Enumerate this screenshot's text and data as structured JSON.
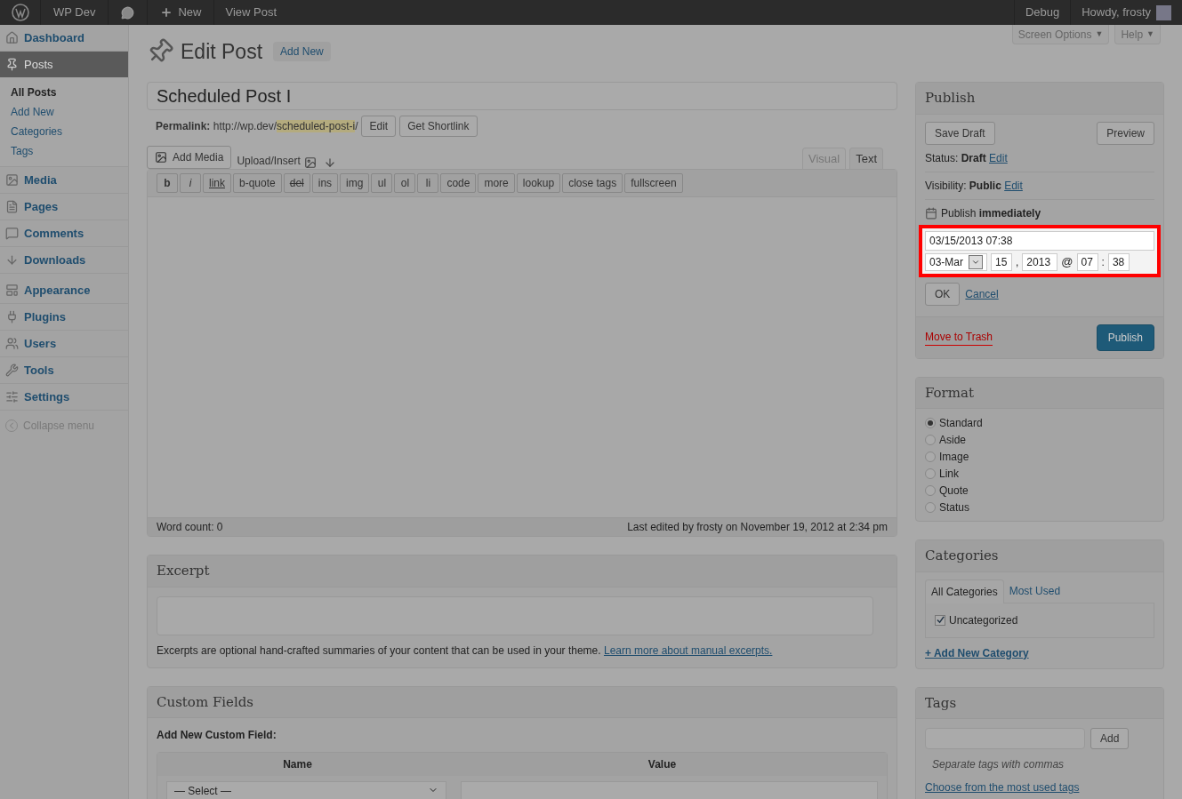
{
  "admin_bar": {
    "site": "WP Dev",
    "new": "New",
    "view": "View Post",
    "debug": "Debug",
    "howdy": "Howdy, frosty"
  },
  "screen_meta": [
    {
      "label": "Screen Options",
      "arrow": "▼"
    },
    {
      "label": "Help",
      "arrow": "▼"
    }
  ],
  "sidebar": {
    "items": [
      {
        "label": "Dashboard",
        "selected": false
      },
      {
        "label": "Posts",
        "selected": true,
        "children": [
          {
            "label": "All Posts",
            "selected": true
          },
          {
            "label": "Add New",
            "selected": false
          },
          {
            "label": "Categories",
            "selected": false
          },
          {
            "label": "Tags",
            "selected": false
          }
        ]
      },
      {
        "label": "Media",
        "selected": false
      },
      {
        "label": "Pages",
        "selected": false
      },
      {
        "label": "Comments",
        "selected": false
      },
      {
        "label": "Downloads",
        "selected": false
      },
      {
        "label": "Appearance",
        "selected": false
      },
      {
        "label": "Plugins",
        "selected": false
      },
      {
        "label": "Users",
        "selected": false
      },
      {
        "label": "Tools",
        "selected": false
      },
      {
        "label": "Settings",
        "selected": false
      }
    ],
    "collapse": "Collapse menu"
  },
  "heading": {
    "title": "Edit Post",
    "add_new": "Add New"
  },
  "post_title": "Scheduled Post I",
  "permalink": {
    "label": "Permalink:",
    "base": "http://wp.dev/",
    "slug": "scheduled-post-i",
    "trail": "/",
    "buttons": [
      "Edit",
      "Get Shortlink"
    ]
  },
  "media": {
    "add": "Add Media",
    "upload": "Upload/Insert"
  },
  "editor_tabs": [
    {
      "label": "Visual",
      "selected": false
    },
    {
      "label": "Text",
      "selected": true
    }
  ],
  "quicktags": [
    {
      "label": "b",
      "kind": "bold"
    },
    {
      "label": "i",
      "kind": "italic"
    },
    {
      "label": "link",
      "kind": "underline"
    },
    {
      "label": "b-quote",
      "kind": "plain"
    },
    {
      "label": "del",
      "kind": "strike"
    },
    {
      "label": "ins",
      "kind": "plain"
    },
    {
      "label": "img",
      "kind": "plain"
    },
    {
      "label": "ul",
      "kind": "plain"
    },
    {
      "label": "ol",
      "kind": "plain"
    },
    {
      "label": "li",
      "kind": "plain"
    },
    {
      "label": "code",
      "kind": "plain"
    },
    {
      "label": "more",
      "kind": "plain"
    },
    {
      "label": "lookup",
      "kind": "plain"
    },
    {
      "label": "close tags",
      "kind": "plain"
    },
    {
      "label": "fullscreen",
      "kind": "plain"
    }
  ],
  "status_bar": {
    "word_count": "Word count: 0",
    "last_edited": "Last edited by frosty on November 19, 2012 at 2:34 pm"
  },
  "excerpt": {
    "title": "Excerpt",
    "help": "Excerpts are optional hand-crafted summaries of your content that can be used in your theme.",
    "link": "Learn more about manual excerpts."
  },
  "custom_fields": {
    "title": "Custom Fields",
    "subtitle": "Add New Custom Field:",
    "columns": [
      "Name",
      "Value"
    ],
    "select": "— Select —"
  },
  "publish": {
    "title": "Publish",
    "save_draft": "Save Draft",
    "preview": "Preview",
    "status_label": "Status:",
    "status": "Draft",
    "status_edit": "Edit",
    "visibility_label": "Visibility:",
    "visibility": "Public",
    "visibility_edit": "Edit",
    "schedule_label": "Publish",
    "schedule": "immediately",
    "datetime": "03/15/2013 07:38",
    "month": "03-Mar",
    "day": "15",
    "comma": ",",
    "year": "2013",
    "at": "@",
    "hour": "07",
    "colon": ":",
    "minute": "38",
    "ok": "OK",
    "cancel": "Cancel",
    "trash": "Move to Trash",
    "publish": "Publish"
  },
  "format": {
    "title": "Format",
    "options": [
      {
        "label": "Standard",
        "selected": true
      },
      {
        "label": "Aside",
        "selected": false
      },
      {
        "label": "Image",
        "selected": false
      },
      {
        "label": "Link",
        "selected": false
      },
      {
        "label": "Quote",
        "selected": false
      },
      {
        "label": "Status",
        "selected": false
      }
    ]
  },
  "categories": {
    "title": "Categories",
    "tabs": [
      {
        "label": "All Categories",
        "selected": true
      },
      {
        "label": "Most Used",
        "selected": false
      }
    ],
    "items": [
      {
        "label": "Uncategorized",
        "checked": true
      }
    ],
    "add": "+ Add New Category"
  },
  "tags": {
    "title": "Tags",
    "add": "Add",
    "hint": "Separate tags with commas",
    "link": "Choose from the most used tags"
  }
}
